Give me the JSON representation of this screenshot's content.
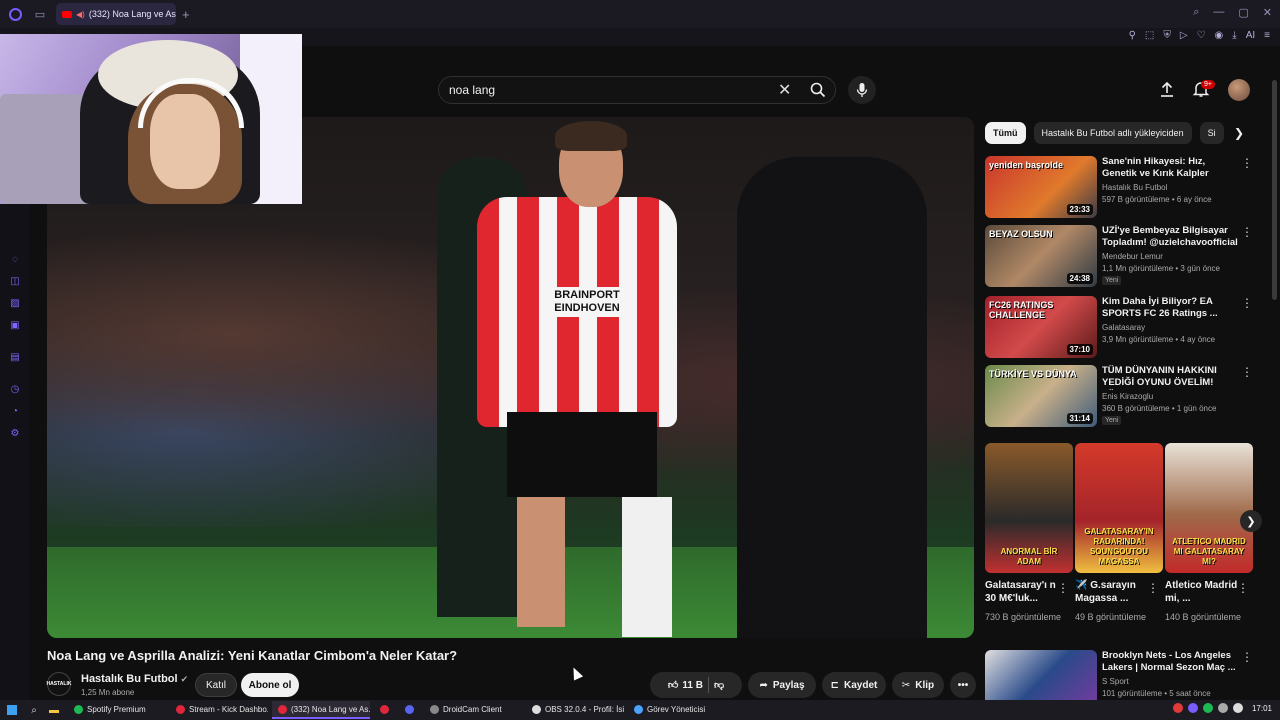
{
  "browser": {
    "tab_title": "(332) Noa Lang ve Asp",
    "new_tab_glyph": "+",
    "toolbar_right_label": "AI"
  },
  "search": {
    "query": "noa lang",
    "notification_count": "9+"
  },
  "video": {
    "title": "Noa Lang ve Asprilla Analizi: Yeni Kanatlar Cimbom'a Neler Katar?",
    "jersey_sponsor": "BRAINPORT EINDHOVEN",
    "channel_name": "Hastalık Bu Futbol",
    "channel_logo_text": "HASTALIK",
    "subscribers": "1,25 Mn abone",
    "join_label": "Katıl",
    "subscribe_label": "Abone ol",
    "likes": "11 B",
    "share_label": "Paylaş",
    "save_label": "Kaydet",
    "clip_label": "Klip"
  },
  "chips": [
    {
      "label": "Tümü",
      "active": true
    },
    {
      "label": "Hastalık Bu Futbol adlı yükleyiciden",
      "active": false
    },
    {
      "label": "Si",
      "active": false
    }
  ],
  "recommendations": [
    {
      "thumb_text": "yeniden başrolde",
      "duration": "23:33",
      "title": "Sane'nin Hikayesi: Hız, Genetik ve Kırık Kalpler",
      "channel": "Hastalık Bu Futbol",
      "meta": "597 B görüntüleme • 6 ay önce",
      "badge": ""
    },
    {
      "thumb_text": "BEYAZ OLSUN",
      "duration": "24:38",
      "title": "UZİ'ye Bembeyaz Bilgisayar Topladım! @uzielchavoofficial",
      "channel": "Mendebur Lemur",
      "meta": "1,1 Mn görüntüleme • 3 gün önce",
      "badge": "Yeni"
    },
    {
      "thumb_text": "FC26 RATINGS CHALLENGE",
      "duration": "37:10",
      "title": "Kim Daha İyi Biliyor? EA SPORTS FC 26 Ratings ...",
      "channel": "Galatasaray",
      "meta": "3,9 Mn görüntüleme • 4 ay önce",
      "badge": ""
    },
    {
      "thumb_text": "TÜRKİYE VS DÜNYA",
      "duration": "31:14",
      "title": "TÜM DÜNYANIN HAKKINI YEDİĞİ OYUNU ÖVELİM! TÜRK ...",
      "channel": "Enis Kirazoglu",
      "meta": "360 B görüntüleme • 1 gün önce",
      "badge": "Yeni"
    }
  ],
  "shorts": [
    {
      "overlay": "ANORMAL BİR ADAM",
      "title": "Galatasaray'ı n 30 M€'luk...",
      "views": "730 B görüntüleme"
    },
    {
      "overlay": "GALATASARAY'IN RADARINDA! SOUNGOUTOU MAGASSA",
      "title": "✈️ G.sarayın Magassa ...",
      "views": "49 B görüntüleme"
    },
    {
      "overlay": "ATLETICO MADRID MI GALATASARAY MI?",
      "title": "Atletico Madrid mi, ...",
      "views": "140 B görüntüleme"
    }
  ],
  "rec_bottom": {
    "title": "Brooklyn Nets - Los Angeles Lakers | Normal Sezon Maç ...",
    "channel": "S Sport",
    "meta": "101 görüntüleme • 5 saat önce"
  },
  "taskbar": {
    "apps": [
      {
        "label": "Spotify Premium",
        "color": "#1db954",
        "active": false
      },
      {
        "label": "Stream - Kick Dashbo...",
        "color": "#e0263a",
        "active": false
      },
      {
        "label": "(332) Noa Lang ve As...",
        "color": "#e0263a",
        "active": true
      },
      {
        "label": "",
        "color": "#e0263a",
        "active": false
      },
      {
        "label": "",
        "color": "#5865f2",
        "active": false
      },
      {
        "label": "DroidCam Client",
        "color": "#888888",
        "active": false
      },
      {
        "label": "OBS 32.0.4 - Profil: İsi...",
        "color": "#dddddd",
        "active": false
      },
      {
        "label": "Görev Yöneticisi",
        "color": "#4aa3ff",
        "active": false
      }
    ],
    "clock": "17:01"
  }
}
